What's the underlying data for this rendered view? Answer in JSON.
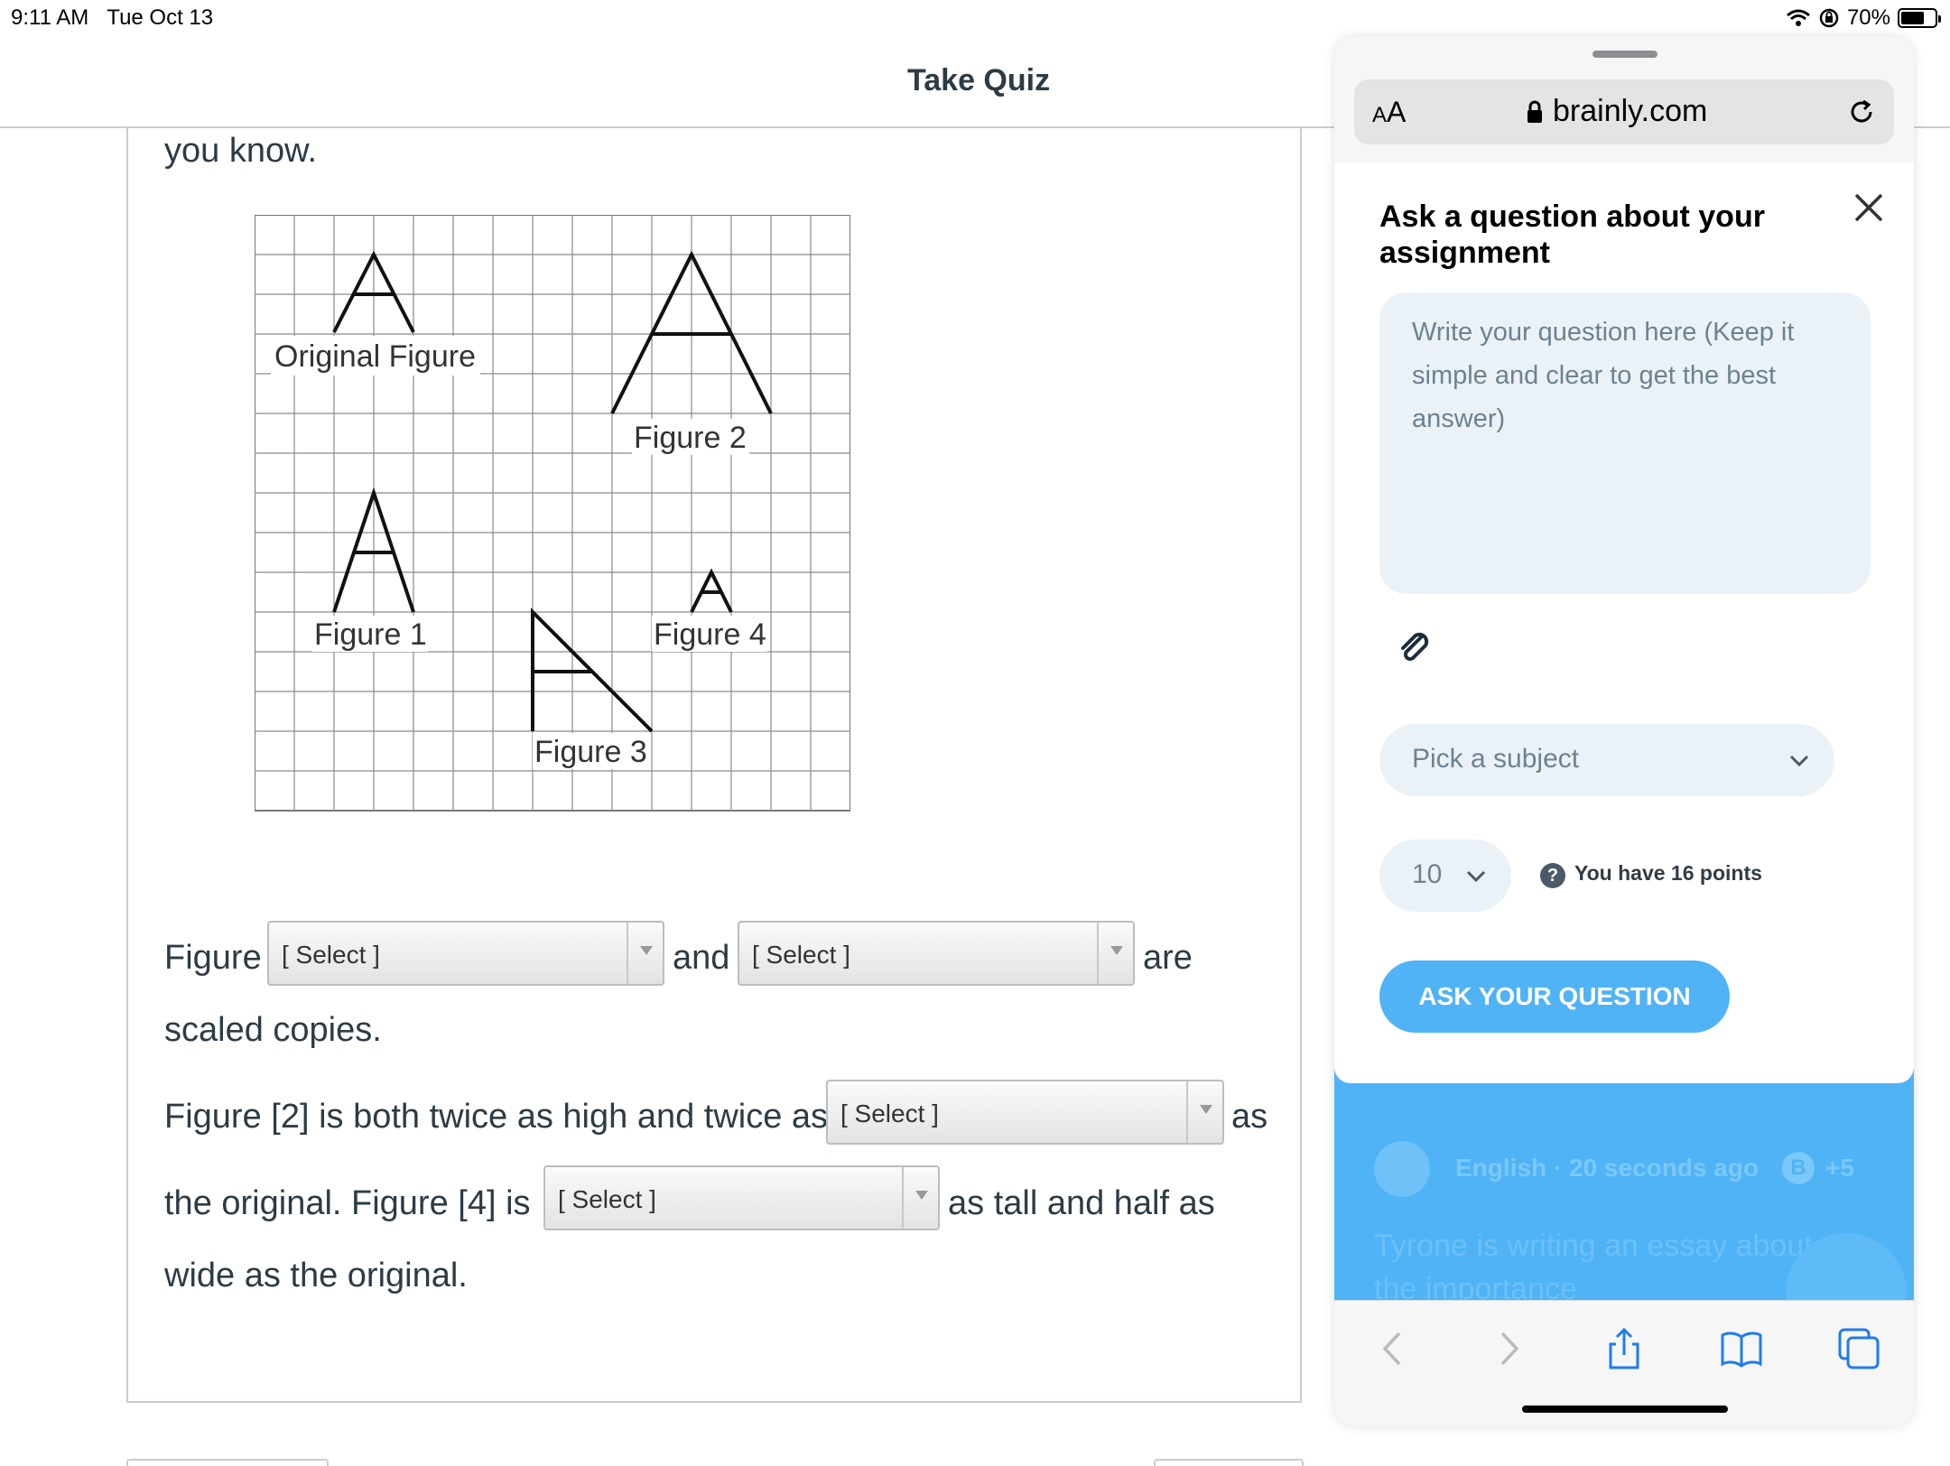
{
  "status_bar": {
    "time": "9:11 AM",
    "date": "Tue Oct 13",
    "battery": "70%",
    "battery_level": 0.7
  },
  "quiz": {
    "title": "Take Quiz",
    "intro_text": "you know.",
    "figure_labels": {
      "original": "Original Figure",
      "figure1": "Figure 1",
      "figure2": "Figure 2",
      "figure3": "Figure 3",
      "figure4": "Figure 4"
    },
    "sentence1": {
      "prefix": "Figure",
      "select1": "[ Select ]",
      "middle": "and",
      "select2": "[ Select ]",
      "suffix": "are",
      "line2": "scaled copies."
    },
    "sentence2": {
      "prefix": "Figure [2] is both twice as high and twice as",
      "select": "[ Select ]",
      "suffix": "as"
    },
    "sentence3": {
      "prefix": "the original. Figure [4] is",
      "select": "[ Select ]",
      "suffix": "as tall and half as",
      "line2": "wide as the original."
    }
  },
  "browser": {
    "text_size_label": "AA",
    "url": "brainly.com"
  },
  "ask_modal": {
    "title": "Ask a question about your assignment",
    "question_placeholder": "Write your question here (Keep it simple and clear to get the best answer)",
    "subject_placeholder": "Pick a subject",
    "points_value": "10",
    "points_info": "You have 16 points",
    "ask_button": "ASK YOUR QUESTION"
  },
  "feed_item": {
    "meta": "English · 20 seconds ago",
    "badge": "B",
    "points": "+5",
    "text": "Tyrone is writing an essay about the importance"
  },
  "colors": {
    "brainly_blue": "#4fb3f6",
    "input_bg": "#ebf2f7",
    "canvas_text": "#2d3b45"
  }
}
